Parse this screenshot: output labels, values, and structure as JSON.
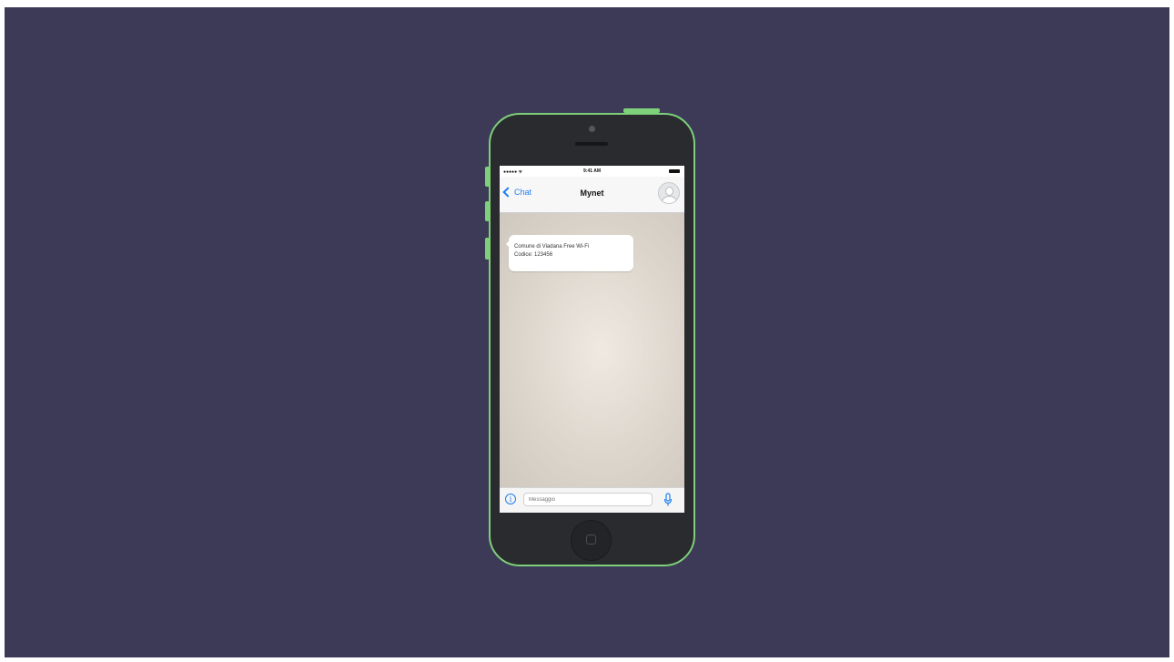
{
  "status_bar": {
    "signal": "●●●●● ᯤ",
    "time": "9:41 AM"
  },
  "nav": {
    "back_label": "Chat",
    "title": "Mynet"
  },
  "messages": [
    {
      "line1": "Comune di Viadana Free Wi-Fi",
      "line2": "Codice: 123456"
    }
  ],
  "input": {
    "placeholder": "Messaggio"
  },
  "icons": {
    "back": "chevron-left-icon",
    "avatar": "contact-avatar-icon",
    "info": "info-icon",
    "mic": "microphone-icon"
  },
  "colors": {
    "background": "#3d3a58",
    "phone_accent": "#7ed07a",
    "phone_body": "#2a2b2e",
    "ios_blue": "#1c7ef0"
  }
}
